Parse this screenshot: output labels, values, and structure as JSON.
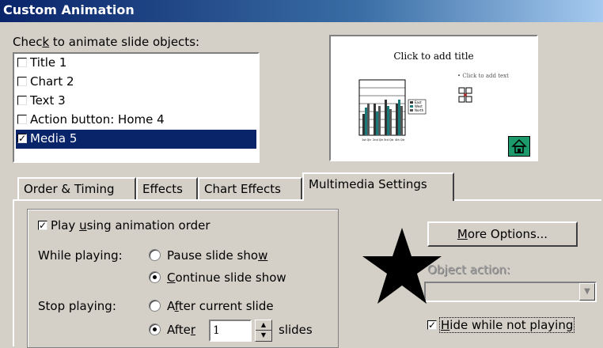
{
  "window": {
    "title": "Custom Animation"
  },
  "objects": {
    "label": "Check to animate slide objects:",
    "items": [
      {
        "label": "Title 1",
        "checked": false,
        "selected": false
      },
      {
        "label": "Chart 2",
        "checked": false,
        "selected": false
      },
      {
        "label": "Text 3",
        "checked": false,
        "selected": false
      },
      {
        "label": "Action button: Home 4",
        "checked": false,
        "selected": false
      },
      {
        "label": "Media 5",
        "checked": true,
        "selected": true
      }
    ]
  },
  "preview": {
    "title": "Click to add title",
    "bullet": "Click to add text",
    "legend": [
      "East",
      "West",
      "North"
    ],
    "chart_categories": [
      "1st Qtr",
      "2nd Qtr",
      "3rd Qtr",
      "4th Qtr"
    ]
  },
  "tabs": [
    {
      "label": "Order & Timing",
      "active": false
    },
    {
      "label": "Effects",
      "active": false
    },
    {
      "label": "Chart Effects",
      "active": false
    },
    {
      "label": "Multimedia Settings",
      "active": true
    }
  ],
  "settings": {
    "play_using_order": {
      "label": "Play using animation order",
      "checked": true
    },
    "while_playing": {
      "label": "While playing:",
      "options": [
        {
          "label": "Pause slide show",
          "selected": false
        },
        {
          "label": "Continue slide show",
          "selected": true
        }
      ]
    },
    "stop_playing": {
      "label": "Stop playing:",
      "options": [
        {
          "label": "After current slide",
          "selected": false
        },
        {
          "label": "After",
          "selected": true
        }
      ],
      "after_value": "1",
      "after_units": "slides"
    },
    "more_options_label": "More Options...",
    "object_action": {
      "label": "Object action:",
      "value": "",
      "disabled": true
    },
    "hide_while_not_playing": {
      "label": "Hide while not playing",
      "checked": true
    }
  }
}
